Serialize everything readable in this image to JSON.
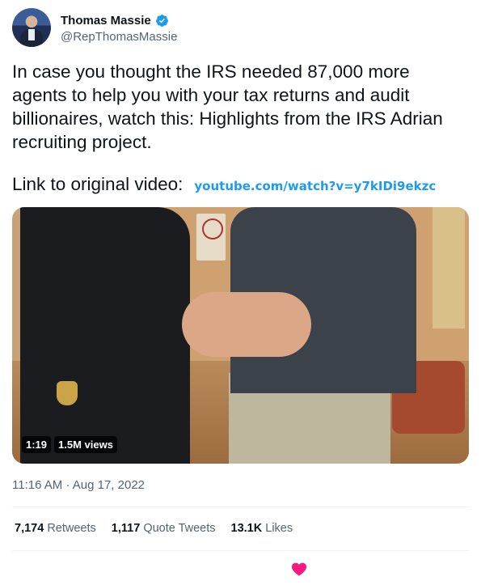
{
  "author": {
    "name": "Thomas Massie",
    "handle": "@RepThomasMassie",
    "verified": true,
    "verified_color": "#1d9bf0"
  },
  "tweet": {
    "text": "In case you thought the IRS needed 87,000 more agents to help you with your tax returns and audit billionaires, watch this: Highlights from the IRS Adrian recruiting project.",
    "link_label": "Link to original video:",
    "link_url": "youtube.com/watch?v=y7kIDi9ekzc"
  },
  "media": {
    "duration": "1:19",
    "views": "1.5M views"
  },
  "timestamp": "11:16 AM · Aug 17, 2022",
  "stats": {
    "retweets_count": "7,174",
    "retweets_label": "Retweets",
    "quote_count": "1,117",
    "quote_label": "Quote Tweets",
    "likes_count": "13.1K",
    "likes_label": "Likes"
  },
  "actions": {
    "like_icon": "heart-icon",
    "like_color": "#f91880",
    "liked": true
  },
  "colors": {
    "text": "#0f1419",
    "secondary": "#536471",
    "link": "#1d9bf0"
  }
}
